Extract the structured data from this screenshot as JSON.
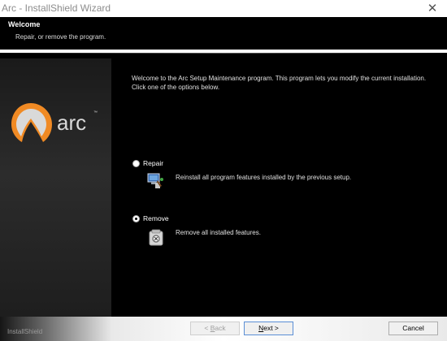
{
  "window": {
    "title": "Arc - InstallShield Wizard",
    "close_glyph": "✕"
  },
  "header": {
    "title": "Welcome",
    "subtitle": "Repair, or remove the program."
  },
  "logo": {
    "text": "arc",
    "trademark": "™"
  },
  "main": {
    "intro": "Welcome to the Arc Setup Maintenance program. This program lets you modify the current installation. Click one of the options below.",
    "options": [
      {
        "label": "Repair",
        "description": "Reinstall all program features installed by the previous setup.",
        "selected": false,
        "icon": "repair-icon"
      },
      {
        "label": "Remove",
        "description": "Remove all installed features.",
        "selected": true,
        "icon": "remove-icon"
      }
    ]
  },
  "footer": {
    "brand": "InstallShield",
    "back_prefix": "< ",
    "back_key": "B",
    "back_rest": "ack",
    "next_key": "N",
    "next_rest": "ext >",
    "cancel_label": "Cancel"
  },
  "colors": {
    "background": "#000000",
    "accent": "#f08a24",
    "text": "#e0e0e0"
  }
}
